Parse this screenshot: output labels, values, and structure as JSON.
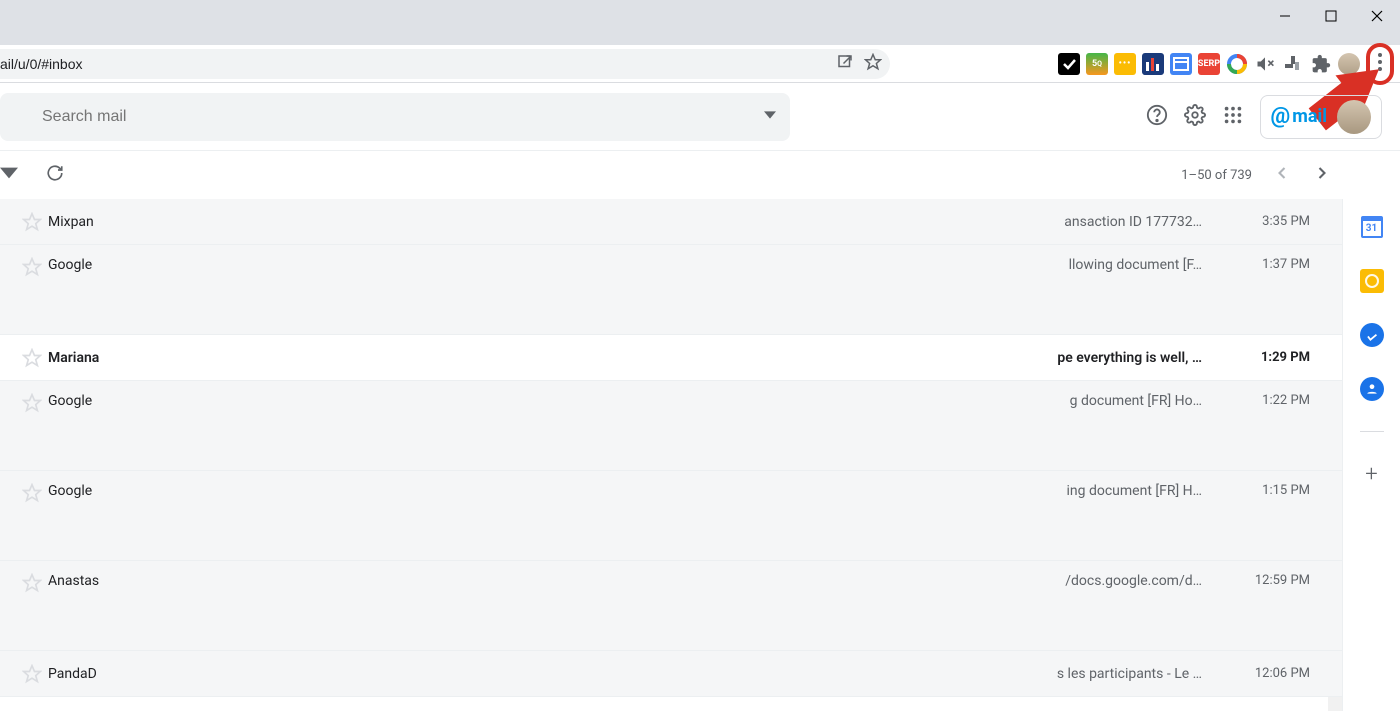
{
  "chrome": {
    "url": "ail/u/0/#inbox",
    "extensions": [
      "todoist",
      "seo50",
      "ellipsis",
      "bars",
      "window",
      "serp",
      "colorwheel",
      "mute",
      "jira",
      "puzzle"
    ]
  },
  "header": {
    "search_placeholder": "Search mail",
    "mailbutler_label": "mail"
  },
  "toolbar": {
    "page_count": "1–50 of 739"
  },
  "side_panel": {
    "calendar_day": "31"
  },
  "emails": [
    {
      "sender": "Mixpan",
      "snippet": "ansaction ID 177732…",
      "time": "3:35 PM",
      "unread": false,
      "tall": false
    },
    {
      "sender": "Google",
      "snippet": "llowing document [F…",
      "time": "1:37 PM",
      "unread": false,
      "tall": true
    },
    {
      "sender": "Mariana",
      "snippet": "pe everything is well, …",
      "time": "1:29 PM",
      "unread": true,
      "tall": false
    },
    {
      "sender": "Google",
      "snippet": "g document [FR] Ho…",
      "time": "1:22 PM",
      "unread": false,
      "tall": true
    },
    {
      "sender": "Google",
      "snippet": "ing document [FR] H…",
      "time": "1:15 PM",
      "unread": false,
      "tall": true
    },
    {
      "sender": "Anastas",
      "snippet": "/docs.google.com/d…",
      "time": "12:59 PM",
      "unread": false,
      "tall": true
    },
    {
      "sender": "PandaD",
      "snippet_prefix": "s les participants",
      "snippet_suffix": " - Le …",
      "time": "12:06 PM",
      "unread": false,
      "tall": false
    }
  ]
}
